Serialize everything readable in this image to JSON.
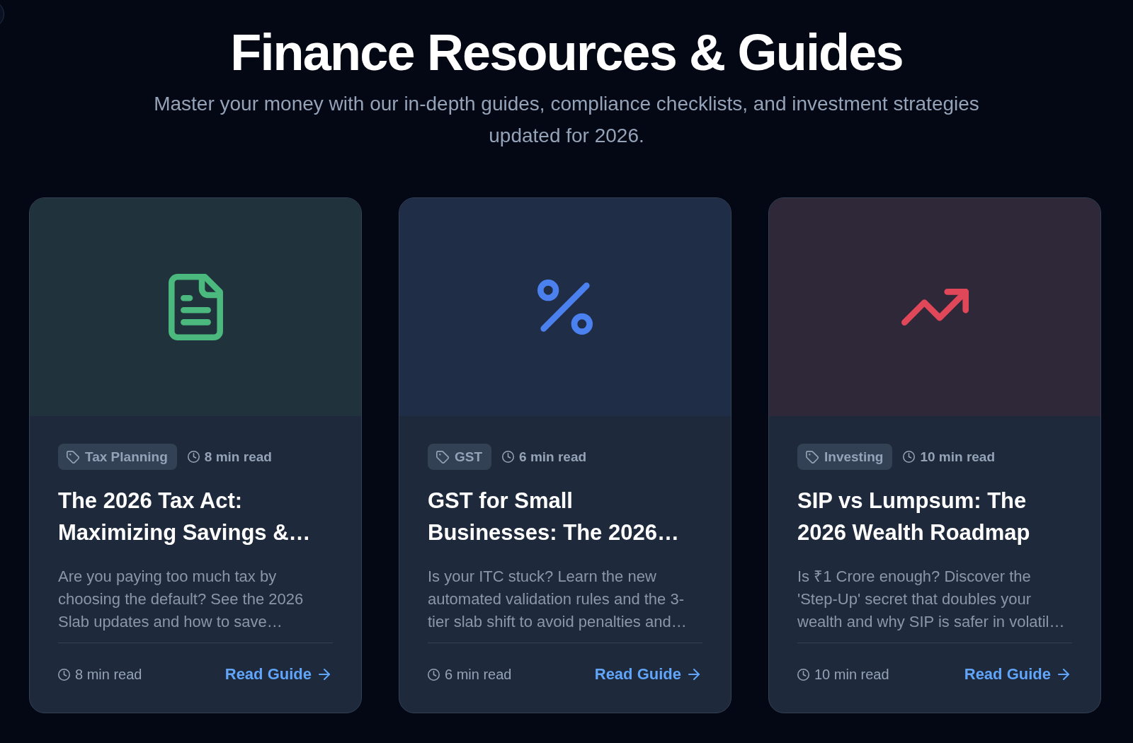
{
  "header": {
    "title": "Finance Resources & Guides",
    "subtitle": "Master your money with our in-depth guides, compliance checklists, and investment strategies updated for 2026."
  },
  "cards": [
    {
      "kind": "document",
      "color": "#4bb87d",
      "tag": "Tax Planning",
      "read_time": "8 min read",
      "title": "The 2026 Tax Act: Maximizing Savings &…",
      "excerpt": "Are you paying too much tax by choosing the default? See the 2026 Slab updates and how to save…",
      "footer_read_time": "8 min read",
      "link": "Read Guide"
    },
    {
      "kind": "percent",
      "color": "#4b80ef",
      "tag": "GST",
      "read_time": "6 min read",
      "title": "GST for Small Businesses: The 2026…",
      "excerpt": "Is your ITC stuck? Learn the new automated validation rules and the 3-tier slab shift to avoid penalties and…",
      "footer_read_time": "6 min read",
      "link": "Read Guide"
    },
    {
      "kind": "trend",
      "color": "#e0485a",
      "tag": "Investing",
      "read_time": "10 min read",
      "title": "SIP vs Lumpsum: The 2026 Wealth Roadmap",
      "excerpt": "Is ₹1 Crore enough? Discover the 'Step-Up' secret that doubles your wealth and why SIP is safer in volatil…",
      "footer_read_time": "10 min read",
      "link": "Read Guide"
    }
  ]
}
